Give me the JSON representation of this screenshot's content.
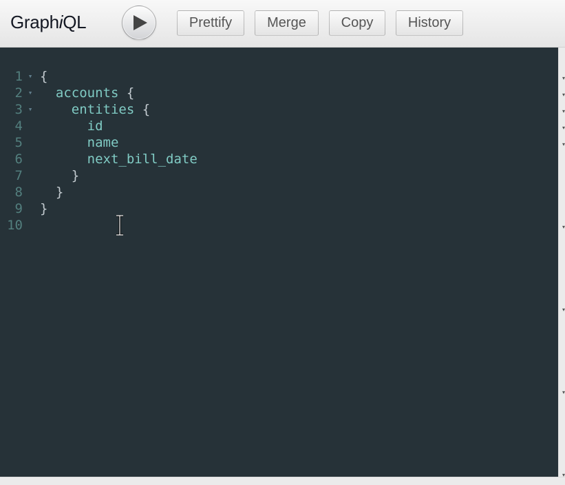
{
  "header": {
    "logo_prefix": "Graph",
    "logo_italic": "i",
    "logo_suffix": "QL",
    "run_icon": "play-icon",
    "buttons": {
      "prettify": "Prettify",
      "merge": "Merge",
      "copy": "Copy",
      "history": "History"
    }
  },
  "editor": {
    "lines": [
      {
        "num": "1",
        "fold": "▾",
        "indent": "",
        "field": "",
        "punct": "{"
      },
      {
        "num": "2",
        "fold": "▾",
        "indent": "  ",
        "field": "accounts",
        "punct": " {"
      },
      {
        "num": "3",
        "fold": "▾",
        "indent": "    ",
        "field": "entities",
        "punct": " {"
      },
      {
        "num": "4",
        "fold": "",
        "indent": "      ",
        "field": "id",
        "punct": ""
      },
      {
        "num": "5",
        "fold": "",
        "indent": "      ",
        "field": "name",
        "punct": ""
      },
      {
        "num": "6",
        "fold": "",
        "indent": "      ",
        "field": "next_bill_date",
        "punct": ""
      },
      {
        "num": "7",
        "fold": "",
        "indent": "    ",
        "field": "",
        "punct": "}"
      },
      {
        "num": "8",
        "fold": "",
        "indent": "  ",
        "field": "",
        "punct": "}"
      },
      {
        "num": "9",
        "fold": "",
        "indent": "",
        "field": "",
        "punct": "}"
      },
      {
        "num": "10",
        "fold": "",
        "indent": "",
        "field": "",
        "punct": ""
      }
    ]
  },
  "colors": {
    "editor_bg": "#263238",
    "field": "#80cbc4",
    "punct": "#c3cbd0",
    "gutter": "#537f7e"
  }
}
